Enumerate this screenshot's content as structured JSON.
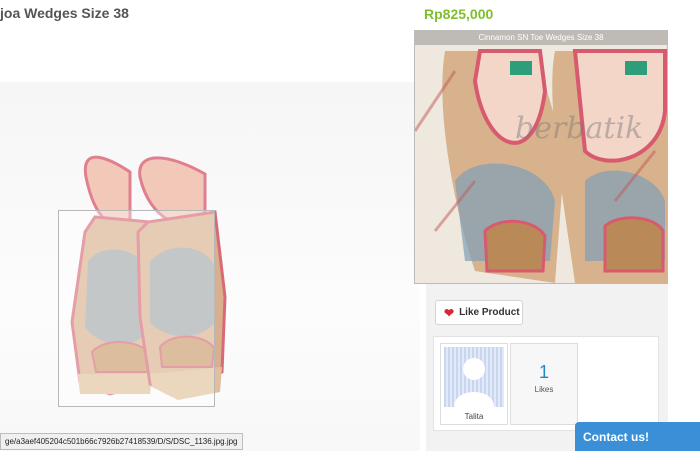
{
  "product": {
    "title": "joa Wedges Size 38",
    "price": "Rp825,000",
    "zoom_caption": "Cinnamon SN Toe Wedges Size 38",
    "watermark": "berbatik"
  },
  "social": {
    "like_label": "Like Product",
    "likers": [
      {
        "name": "Talita"
      }
    ],
    "likes_count": "1",
    "likes_label": "Likes"
  },
  "status_bar": {
    "url": "ge/a3aef405204c501b66c7926b27418539/D/S/DSC_1136.jpg.jpg"
  },
  "contact": {
    "label": "Contact us!"
  },
  "colors": {
    "price": "#7fbf2e",
    "accent": "#3a8fd6",
    "likes_count": "#1e88c8",
    "heart": "#d9262f"
  },
  "icons": [
    "heart-icon",
    "avatar-placeholder-icon"
  ]
}
